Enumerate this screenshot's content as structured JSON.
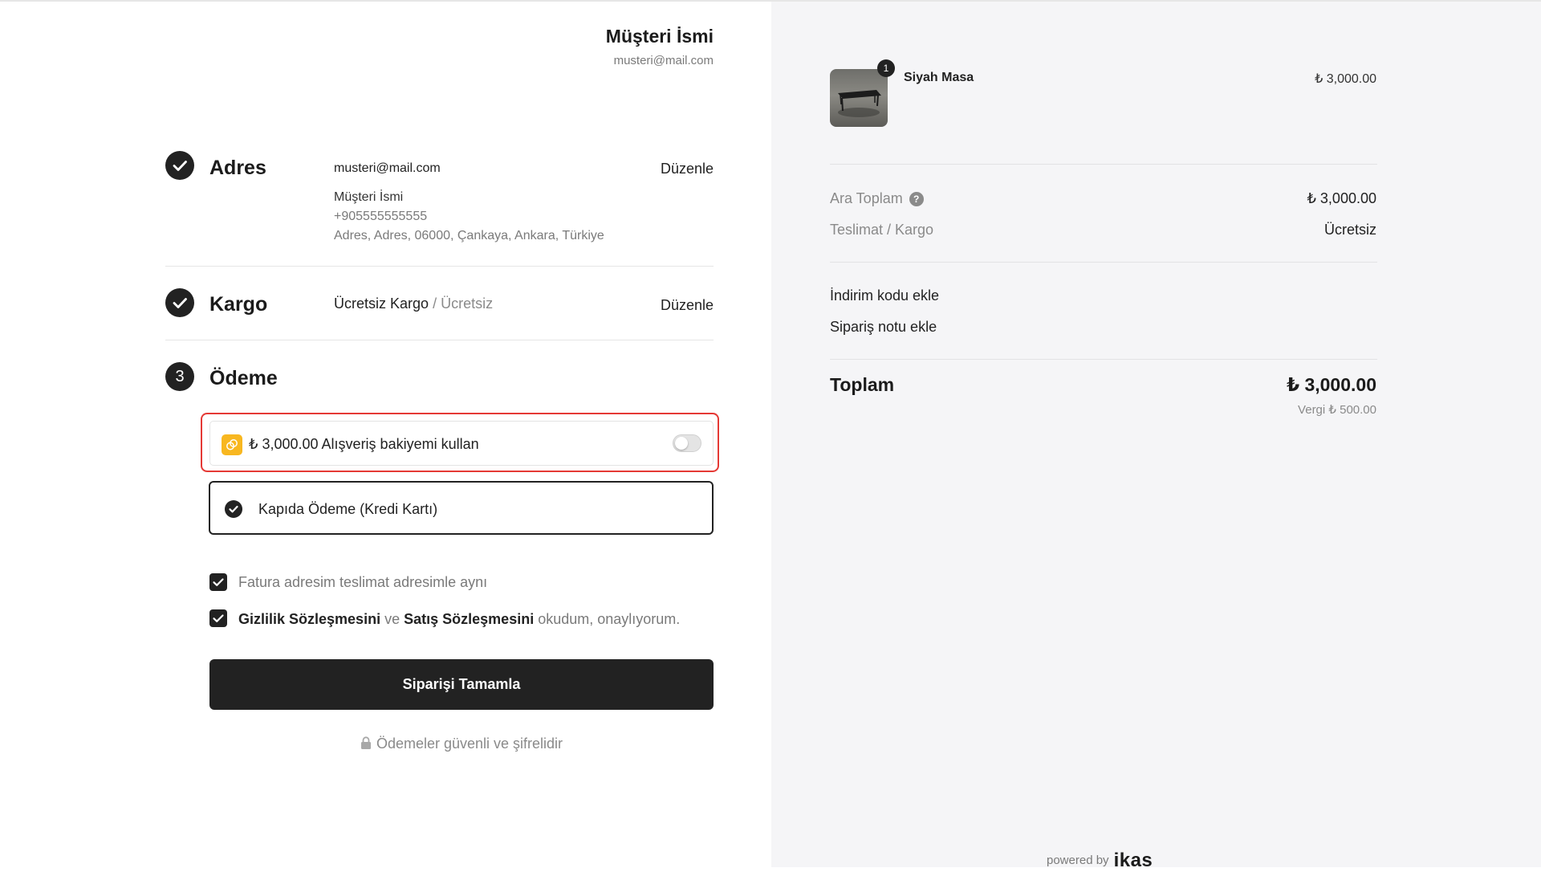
{
  "customer": {
    "name": "Müşteri İsmi",
    "email": "musteri@mail.com"
  },
  "steps": {
    "address": {
      "title": "Adres",
      "edit_label": "Düzenle",
      "email": "musteri@mail.com",
      "name": "Müşteri İsmi",
      "phone": "+905555555555",
      "full_address": "Adres, Adres, 06000, Çankaya, Ankara, Türkiye"
    },
    "shipping": {
      "title": "Kargo",
      "edit_label": "Düzenle",
      "method": "Ücretsiz Kargo",
      "separator": "/",
      "price": "Ücretsiz"
    },
    "payment": {
      "number": "3",
      "title": "Ödeme",
      "balance_amount": "₺ 3,000.00",
      "balance_label": "Alışveriş bakiyemi kullan",
      "balance_enabled": false,
      "option_label": "Kapıda Ödeme (Kredi Kartı)"
    }
  },
  "agreements": {
    "billing_same": "Fatura adresim teslimat adresimle aynı",
    "privacy_link": "Gizlilik Sözleşmesini",
    "and": "ve",
    "sales_link": "Satış Sözleşmesini",
    "accept_suffix": "okudum, onaylıyorum."
  },
  "submit_label": "Siparişi Tamamla",
  "secure_note": "Ödemeler güvenli ve şifrelidir",
  "summary": {
    "product": {
      "name": "Siyah Masa",
      "price": "₺ 3,000.00",
      "quantity": "1"
    },
    "subtotal_label": "Ara Toplam",
    "subtotal_value": "₺ 3,000.00",
    "help_icon": "?",
    "shipping_label": "Teslimat / Kargo",
    "shipping_value": "Ücretsiz",
    "discount_link": "İndirim kodu ekle",
    "note_link": "Sipariş notu ekle",
    "total_label": "Toplam",
    "total_value": "₺ 3,000.00",
    "tax_text": "Vergi ₺ 500.00"
  },
  "footer": {
    "powered_by": "powered by",
    "brand": "ikas"
  },
  "colors": {
    "accent_dark": "#222222",
    "highlight_red": "#e53935",
    "coin_yellow": "#f8b720",
    "panel_bg": "#f5f5f7"
  }
}
